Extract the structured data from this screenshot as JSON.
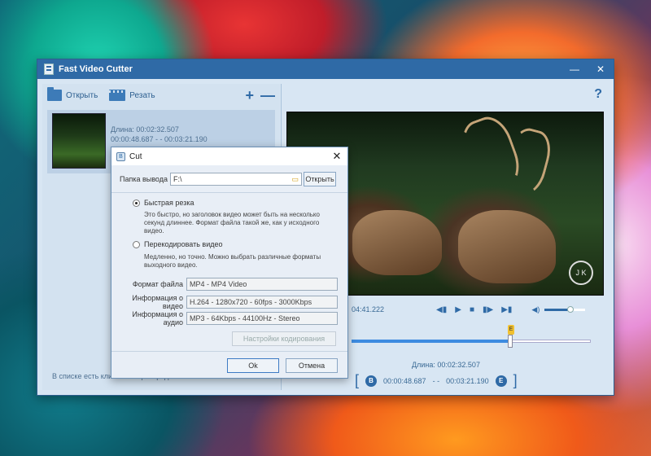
{
  "window": {
    "title": "Fast Video Cutter",
    "minimize": "—",
    "close": "✕"
  },
  "toolbar": {
    "open_label": "Открыть",
    "cut_label": "Резать",
    "add": "+",
    "remove": "—",
    "help": "?"
  },
  "clip": {
    "duration": "Длина: 00:02:32.507",
    "range": "00:00:48.687 - - 00:03:21.190"
  },
  "status": "В списке есть клип 1. Общая продолжительность 00:02:32.507",
  "player": {
    "time": "04:41.222",
    "watermark": "J K"
  },
  "range": {
    "duration": "Длина: 00:02:32.507",
    "open_bracket": "[",
    "start_icon": "B",
    "start": "00:00:48.687",
    "sep": "- -",
    "end": "00:03:21.190",
    "end_icon": "E",
    "close_bracket": "]"
  },
  "dialog": {
    "title": "Cut",
    "close": "✕",
    "output_label": "Папка вывода",
    "output_value": "F:\\",
    "open_button": "Открыть",
    "fast_cut_label": "Быстрая резка",
    "fast_cut_desc": "Это быстро, но заголовок видео может быть на несколько секунд длиннее. Формат файла такой же, как у исходного видео.",
    "reencode_label": "Перекодировать видео",
    "reencode_desc": "Медленно, но точно. Можно выбрать различные форматы выходного видео.",
    "format_label": "Формат файла",
    "format_value": "MP4 - MP4 Video",
    "video_label": "Информация о видео",
    "video_value": "H.264 - 1280x720 - 60fps - 3000Kbps",
    "audio_label": "Информация о аудио",
    "audio_value": "MP3 - 64Kbps - 44100Hz - Stereo",
    "encoding_button": "Настройки кодирования",
    "ok_button": "Ok",
    "cancel_button": "Отмена",
    "selected_mode": "fast"
  },
  "colors": {
    "accent": "#2f6aa6",
    "panel": "#d8e6f3"
  }
}
